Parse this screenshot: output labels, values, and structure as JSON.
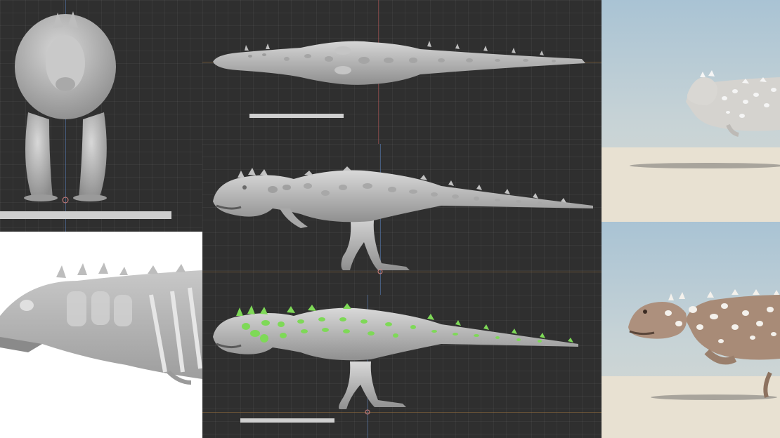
{
  "images": {
    "front_view": "dinosaur-model-front-view",
    "top_view": "dinosaur-model-top-view",
    "side_view": "dinosaur-model-side-view",
    "side_view_highlighted": "dinosaur-model-side-view-osteoderms-highlighted",
    "head_xray": "dinosaur-head-skeleton-overlay",
    "render_plain": "dinosaur-render-white",
    "render_textured": "dinosaur-render-brown-spotted"
  },
  "colors": {
    "viewport_bg": "#2f2f2f",
    "model_gray": "#b9b9b9",
    "highlight_green": "#7ed957",
    "scale_bar": "#cfcfcf",
    "render_brown": "#a88b77",
    "sand": "#e8e1d2"
  }
}
